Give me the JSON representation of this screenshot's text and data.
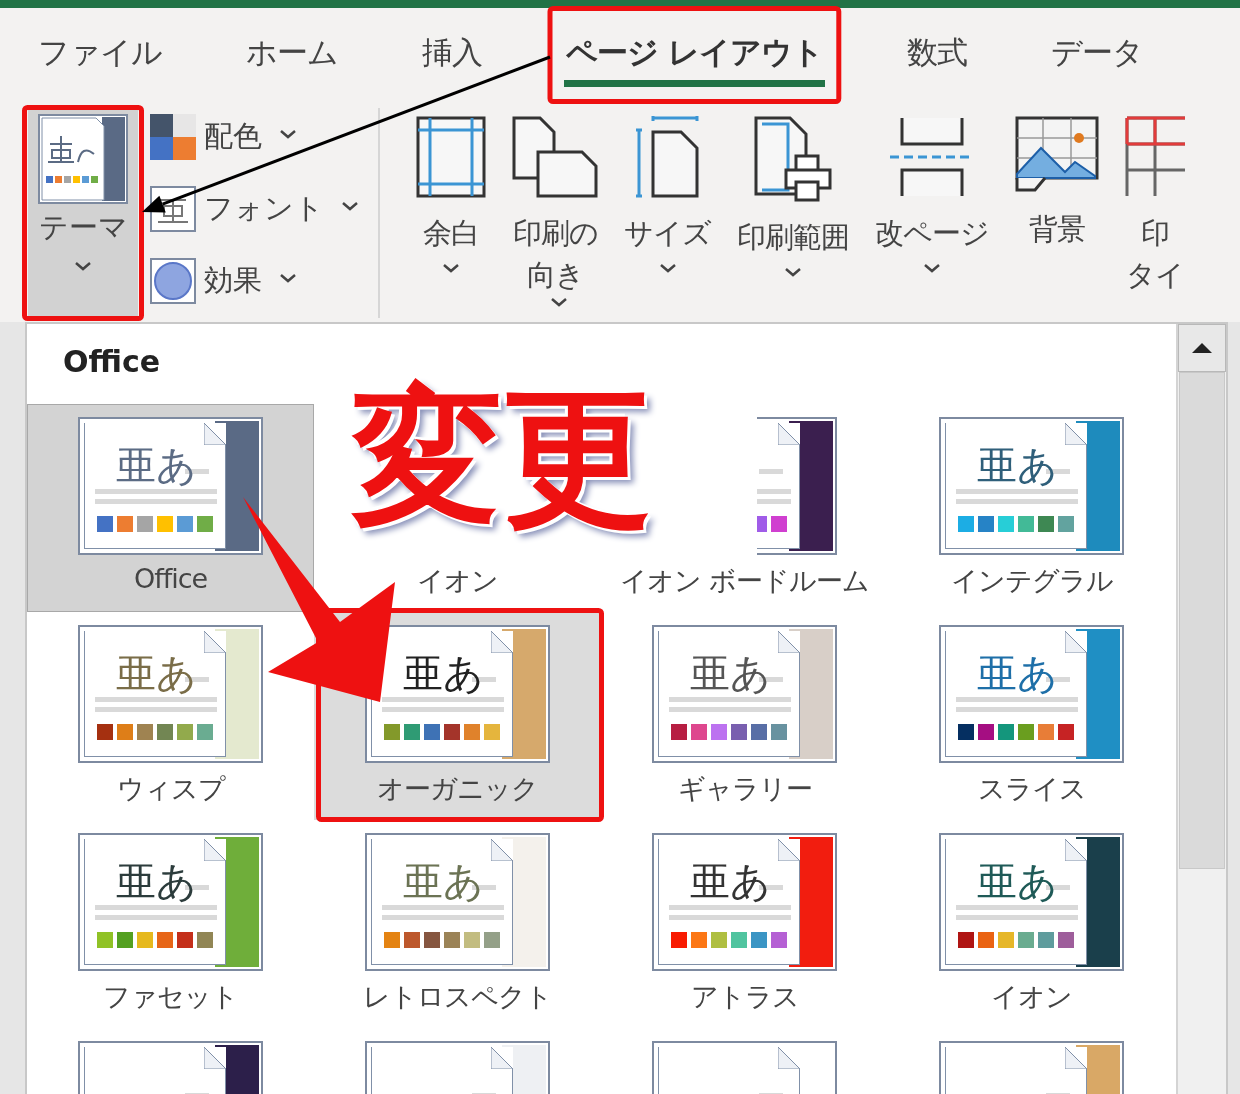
{
  "tabs": [
    {
      "label": "ファイル",
      "selected": false
    },
    {
      "label": "ホーム",
      "selected": false
    },
    {
      "label": "挿入",
      "selected": false
    },
    {
      "label": "ページ レイアウト",
      "selected": true
    },
    {
      "label": "数式",
      "selected": false
    },
    {
      "label": "データ",
      "selected": false
    }
  ],
  "ribbon": {
    "theme_button": {
      "label": "テーマ",
      "pressed": true
    },
    "small_buttons": [
      {
        "label": "配色",
        "kind": "colors"
      },
      {
        "label": "フォント",
        "kind": "fonts"
      },
      {
        "label": "効果",
        "kind": "effects"
      }
    ],
    "big_buttons": [
      {
        "lines": [
          "余白"
        ],
        "kind": "margins",
        "dropdown": true
      },
      {
        "lines": [
          "印刷の",
          "向き"
        ],
        "kind": "orientation",
        "dropdown": true
      },
      {
        "lines": [
          "サイズ"
        ],
        "kind": "size",
        "dropdown": true
      },
      {
        "lines": [
          "印刷範囲"
        ],
        "kind": "print_area",
        "dropdown": true
      },
      {
        "lines": [
          "改ページ"
        ],
        "kind": "breaks",
        "dropdown": true
      },
      {
        "lines": [
          "背景"
        ],
        "kind": "background",
        "dropdown": false
      },
      {
        "lines": [
          "印",
          "タイ"
        ],
        "kind": "print_titles",
        "dropdown": false
      }
    ]
  },
  "gallery": {
    "heading": "Office",
    "themes": [
      {
        "label": "Office",
        "selected": true,
        "hovered": false,
        "sample": {
          "text": "亜あ",
          "color": "#5b6b84"
        },
        "color": "#5a6a85",
        "swatches": [
          {
            "color": "#4472c4"
          },
          {
            "color": "#ed7d31"
          },
          {
            "color": "#a5a5a5"
          },
          {
            "color": "#ffc000"
          },
          {
            "color": "#5b9bd5"
          },
          {
            "color": "#70ad47"
          }
        ]
      },
      {
        "label": "イオン",
        "selected": false,
        "hovered": false
      },
      {
        "label": "イオン ボードルーム",
        "selected": false,
        "hovered": false,
        "color": "#3b1f4f",
        "swatches": [
          {
            "color": "#a05ce8"
          },
          {
            "color": "#d03fd0"
          }
        ]
      },
      {
        "label": "インテグラル",
        "selected": false,
        "hovered": false,
        "sample": {
          "text": "亜あ",
          "color": "#2f5f7a"
        },
        "color": "#1e8bbd",
        "swatches": [
          {
            "color": "#1cade4"
          },
          {
            "color": "#2683c6"
          },
          {
            "color": "#27ced7"
          },
          {
            "color": "#42ba97"
          },
          {
            "color": "#3e8853"
          },
          {
            "color": "#62a39f"
          }
        ]
      },
      {
        "label": "ウィスプ",
        "selected": false,
        "hovered": false,
        "sample": {
          "text": "亜あ",
          "color": "#7a6d48"
        },
        "color": "#e4e9cf",
        "swatches": [
          {
            "color": "#a53010"
          },
          {
            "color": "#de7e18"
          },
          {
            "color": "#9f8351"
          },
          {
            "color": "#728653"
          },
          {
            "color": "#92aa4c"
          },
          {
            "color": "#6aac91"
          }
        ]
      },
      {
        "label": "オーガニック",
        "selected": false,
        "hovered": true,
        "sample": {
          "text": "亜あ",
          "color": "#222222"
        },
        "color": "#d6a96c",
        "swatches": [
          {
            "color": "#83992a"
          },
          {
            "color": "#2f9b74"
          },
          {
            "color": "#3e72b5"
          },
          {
            "color": "#a4342a"
          },
          {
            "color": "#e0822b"
          },
          {
            "color": "#e5b53d"
          }
        ]
      },
      {
        "label": "ギャラリー",
        "selected": false,
        "hovered": false,
        "sample": {
          "text": "亜あ",
          "color": "#555555"
        },
        "color": "#d8cfc8",
        "swatches": [
          {
            "color": "#b71e42"
          },
          {
            "color": "#de478e"
          },
          {
            "color": "#bc72f0"
          },
          {
            "color": "#795faf"
          },
          {
            "color": "#586ea6"
          },
          {
            "color": "#6892a0"
          }
        ]
      },
      {
        "label": "スライス",
        "selected": false,
        "hovered": false,
        "sample": {
          "text": "亜あ",
          "color": "#1e6fa8"
        },
        "color": "#1f8fc4",
        "swatches": [
          {
            "color": "#052f61"
          },
          {
            "color": "#a50e82"
          },
          {
            "color": "#14967c"
          },
          {
            "color": "#6a9e1f"
          },
          {
            "color": "#e87d37"
          },
          {
            "color": "#c62324"
          }
        ]
      },
      {
        "label": "ファセット",
        "selected": false,
        "hovered": false,
        "sample": {
          "text": "亜あ",
          "color": "#2c3c3c"
        },
        "color": "#6fae3a",
        "swatches": [
          {
            "color": "#90c226"
          },
          {
            "color": "#54a021"
          },
          {
            "color": "#e6b91e"
          },
          {
            "color": "#e76618"
          },
          {
            "color": "#c42f1a"
          },
          {
            "color": "#918655"
          }
        ]
      },
      {
        "label": "レトロスペクト",
        "selected": false,
        "hovered": false,
        "sample": {
          "text": "亜あ",
          "color": "#6b7354"
        },
        "color": "#f4f1ec",
        "swatches": [
          {
            "color": "#e48312"
          },
          {
            "color": "#bd582c"
          },
          {
            "color": "#865640"
          },
          {
            "color": "#9b8357"
          },
          {
            "color": "#c2bc80"
          },
          {
            "color": "#94a088"
          }
        ]
      },
      {
        "label": "アトラス",
        "selected": false,
        "hovered": false,
        "sample": {
          "text": "亜あ",
          "color": "#333333"
        },
        "color": "#f21d0f",
        "swatches": [
          {
            "color": "#f81b02"
          },
          {
            "color": "#fc7715"
          },
          {
            "color": "#afbf41"
          },
          {
            "color": "#50c49f"
          },
          {
            "color": "#3b95c4"
          },
          {
            "color": "#b560d4"
          }
        ]
      },
      {
        "label": "イオン",
        "selected": false,
        "hovered": false,
        "sample": {
          "text": "亜あ",
          "color": "#1f5a57"
        },
        "color": "#1a3f4b",
        "swatches": [
          {
            "color": "#b01513"
          },
          {
            "color": "#ea6312"
          },
          {
            "color": "#e6b729"
          },
          {
            "color": "#6aac90"
          },
          {
            "color": "#5f9c9d"
          },
          {
            "color": "#9e5e9b"
          }
        ]
      },
      {
        "selected": false,
        "hovered": false,
        "color": "#2c1f4a"
      },
      {
        "selected": false,
        "hovered": false,
        "color": "#eef0f3"
      },
      {
        "selected": false,
        "hovered": false
      },
      {
        "selected": false,
        "hovered": false,
        "color": "#d9a866"
      }
    ]
  },
  "annotations": {
    "callout": "変更"
  }
}
